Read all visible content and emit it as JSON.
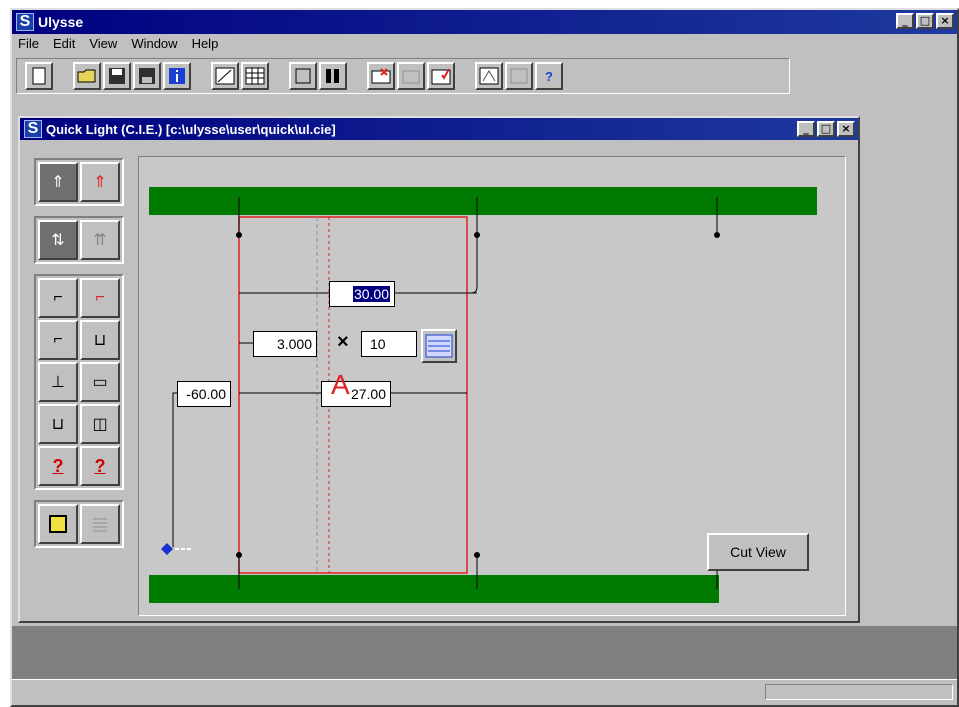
{
  "app": {
    "title": "Ulysse",
    "logo_letter": "S",
    "window_buttons": [
      "_",
      "□",
      "×"
    ]
  },
  "menu": [
    "File",
    "Edit",
    "View",
    "Window",
    "Help"
  ],
  "toolbar": [
    {
      "icon": "new-doc-icon"
    },
    {
      "icon": "open-folder-icon"
    },
    {
      "icon": "save-icon"
    },
    {
      "icon": "save-as-icon"
    },
    {
      "icon": "info-icon"
    },
    {
      "icon": "chart-icon"
    },
    {
      "icon": "table-icon"
    },
    {
      "icon": "bracket-icon"
    },
    {
      "icon": "double-bar-icon"
    },
    {
      "icon": "delete-x-icon"
    },
    {
      "icon": "disabled-icon"
    },
    {
      "icon": "check-chart-icon"
    },
    {
      "icon": "photometry-icon"
    },
    {
      "icon": "report-icon"
    },
    {
      "icon": "help-question-icon",
      "label": "?"
    }
  ],
  "child": {
    "title": "Quick Light (C.I.E.) [c:\\ulysse\\user\\quick\\ul.cie]"
  },
  "canvas": {
    "spacing": "30.00",
    "count_value": "3.000",
    "times": "×",
    "count": "10",
    "left_offset": "-60.00",
    "width": "27.00",
    "area_label": "A",
    "cut_view": "Cut View"
  },
  "palette": {
    "help_label": "?"
  },
  "colors": {
    "rail": "#007a00",
    "room_outline": "#e02020",
    "selection": "#000080",
    "marker": "#1a2fd0"
  }
}
